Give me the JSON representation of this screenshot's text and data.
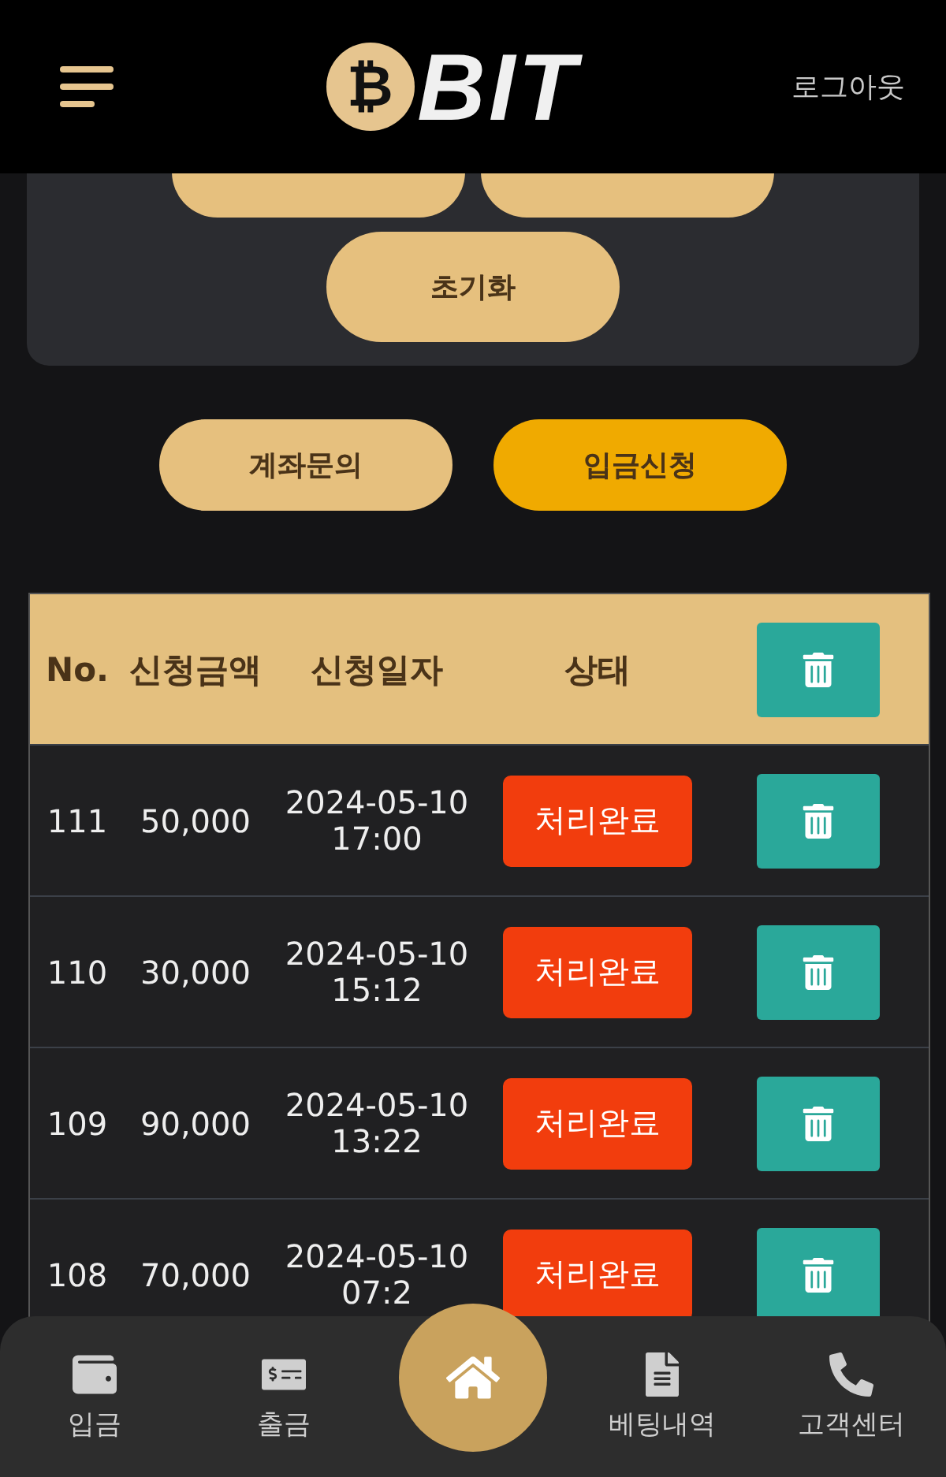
{
  "header": {
    "logo_symbol": "₿",
    "logo_text": "BIT",
    "logout": "로그아웃"
  },
  "panel": {
    "reset_button": "초기화"
  },
  "actions": [
    {
      "label": "계좌문의",
      "selected": false
    },
    {
      "label": "입금신청",
      "selected": true
    }
  ],
  "table": {
    "columns": [
      "No.",
      "신청금액",
      "신청일자",
      "상태"
    ],
    "rows": [
      {
        "no": "111",
        "amount": "50,000",
        "date": "2024-05-10",
        "time": "17:00",
        "status": "처리완료"
      },
      {
        "no": "110",
        "amount": "30,000",
        "date": "2024-05-10",
        "time": "15:12",
        "status": "처리완료"
      },
      {
        "no": "109",
        "amount": "90,000",
        "date": "2024-05-10",
        "time": "13:22",
        "status": "처리완료"
      },
      {
        "no": "108",
        "amount": "70,000",
        "date": "2024-05-10",
        "time": "07:2",
        "status": "처리완료"
      }
    ]
  },
  "bottom_nav": [
    {
      "kind": "wallet",
      "label": "입금"
    },
    {
      "kind": "atm",
      "label": "출금"
    },
    {
      "kind": "home"
    },
    {
      "kind": "history",
      "label": "베팅내역"
    },
    {
      "kind": "support",
      "label": "고객센터"
    }
  ]
}
